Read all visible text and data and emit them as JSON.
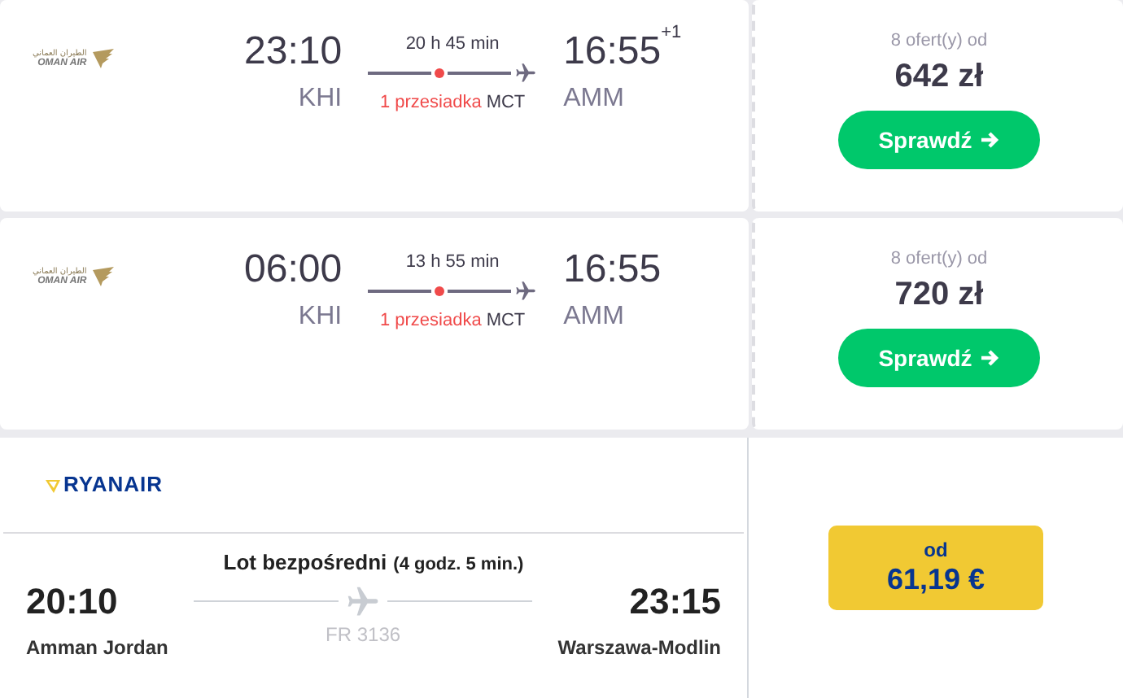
{
  "offers": [
    {
      "airline": {
        "arabic": "الطيران العماني",
        "name": "OMAN AIR"
      },
      "departure": {
        "time": "23:10",
        "airport": "KHI"
      },
      "duration": "20 h 45 min",
      "stops": "1 przesiadka",
      "via": "MCT",
      "arrival": {
        "time": "16:55",
        "airport": "AMM",
        "day_offset": "+1"
      },
      "offers_count": "8 ofert(y) od",
      "price": "642 zł",
      "button": "Sprawdź"
    },
    {
      "airline": {
        "arabic": "الطيران العماني",
        "name": "OMAN AIR"
      },
      "departure": {
        "time": "06:00",
        "airport": "KHI"
      },
      "duration": "13 h 55 min",
      "stops": "1 przesiadka",
      "via": "MCT",
      "arrival": {
        "time": "16:55",
        "airport": "AMM"
      },
      "offers_count": "8 ofert(y) od",
      "price": "720 zł",
      "button": "Sprawdź"
    }
  ],
  "direct_offer": {
    "airline": "RYANAIR",
    "flight_type": "Lot bezpośredni",
    "duration": "(4 godz. 5 min.)",
    "departure": {
      "time": "20:10",
      "city": "Amman Jordan"
    },
    "flight_number": "FR 3136",
    "arrival": {
      "time": "23:15",
      "city": "Warszawa-Modlin"
    },
    "price_label": "od",
    "price": "61,19 €"
  }
}
